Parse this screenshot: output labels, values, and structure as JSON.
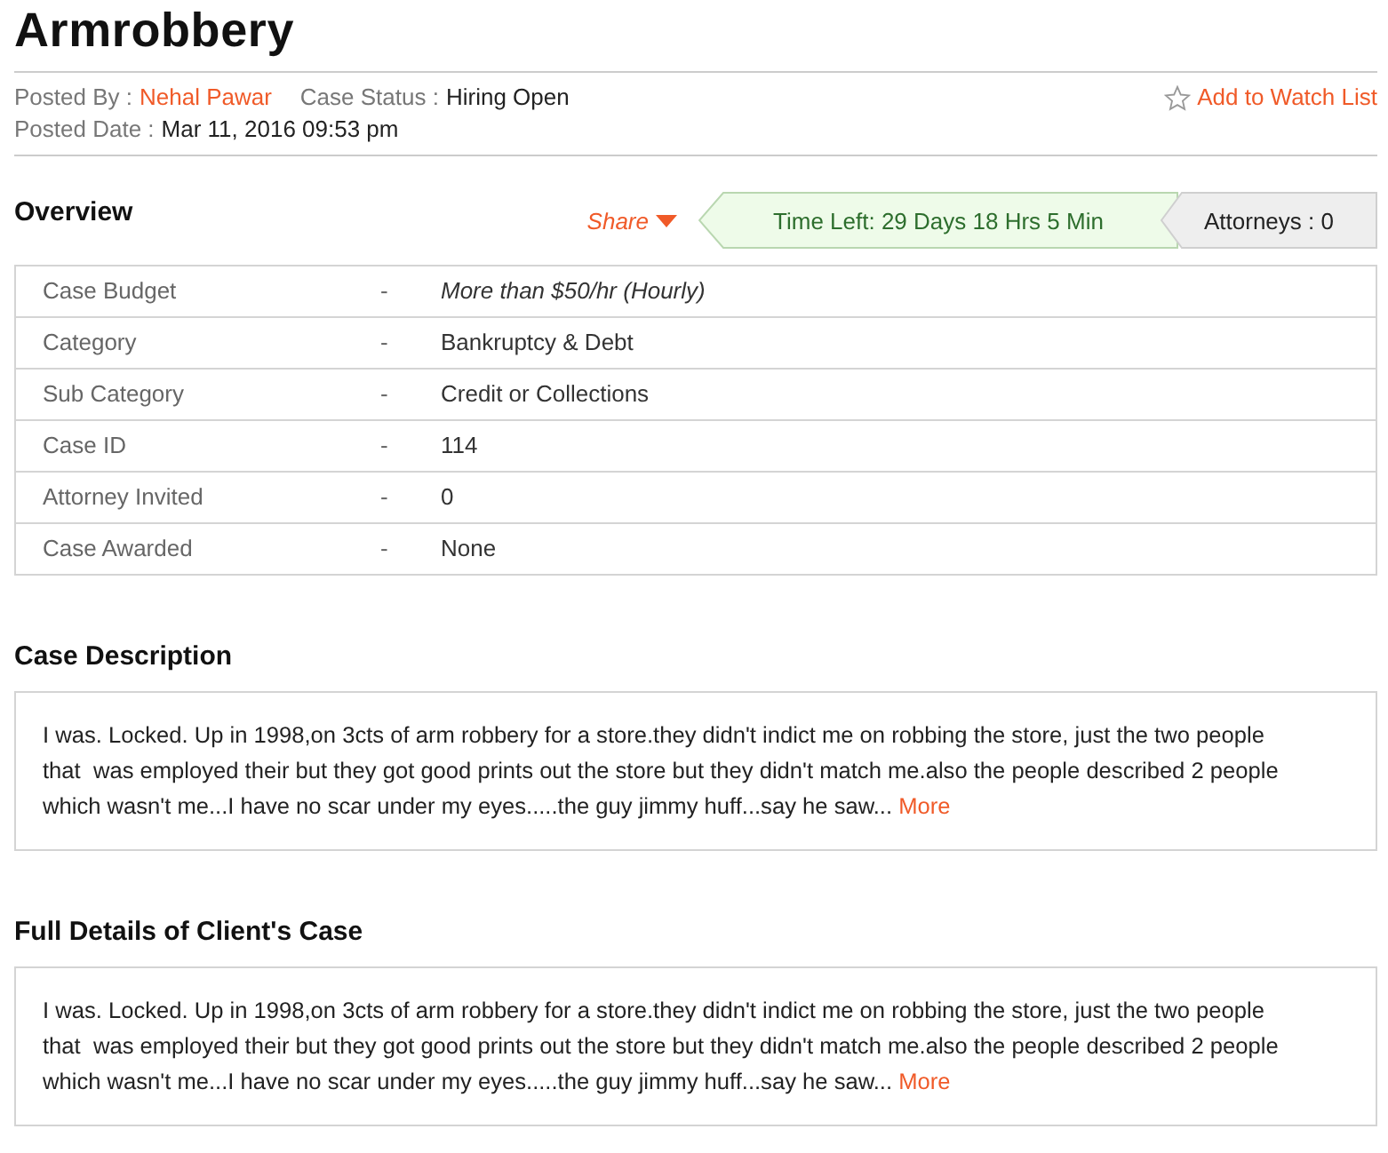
{
  "title": "Armrobbery",
  "meta": {
    "posted_by_label": "Posted By :",
    "posted_by": "Nehal Pawar",
    "status_label": "Case Status :",
    "status": "Hiring Open",
    "date_label": "Posted Date :",
    "date": "Mar 11, 2016 09:53 pm",
    "watch": "Add to Watch List"
  },
  "overview": {
    "heading": "Overview",
    "share": "Share",
    "time_left": "Time Left: 29 Days 18 Hrs 5 Min",
    "attorneys": "Attorneys : 0"
  },
  "details": [
    {
      "label": "Case Budget",
      "sep": "-",
      "value": "More than $50/hr (Hourly)",
      "kind": "emphasis"
    },
    {
      "label": "Category",
      "sep": "-",
      "value": "Bankruptcy & Debt",
      "kind": "plain"
    },
    {
      "label": "Sub Category",
      "sep": "-",
      "value": "Credit or Collections",
      "kind": "plain"
    },
    {
      "label": "Case ID",
      "sep": "-",
      "value": "114",
      "kind": "plain"
    },
    {
      "label": "Attorney Invited",
      "sep": "-",
      "value": "0",
      "kind": "plain"
    },
    {
      "label": "Case Awarded",
      "sep": "-",
      "value": "None",
      "kind": "plain"
    }
  ],
  "sections": [
    {
      "heading": "Case Description",
      "text": "I was. Locked. Up in 1998,on 3cts of arm robbery for a store.they didn't indict me on robbing the store, just the two people that  was employed their but they got good prints out the store but they didn't match me.also the people described 2 people which wasn't me...I have no scar under my eyes.....the guy jimmy huff...say he saw...",
      "link": "More"
    },
    {
      "heading": "Full Details of Client's Case",
      "text": "I was. Locked. Up in 1998,on 3cts of arm robbery for a store.they didn't indict me on robbing the store, just the two people that  was employed their but they got good prints out the store but they didn't match me.also the people described 2 people which wasn't me...I have no scar under my eyes.....the guy jimmy huff...say he saw...",
      "link": "More"
    }
  ]
}
